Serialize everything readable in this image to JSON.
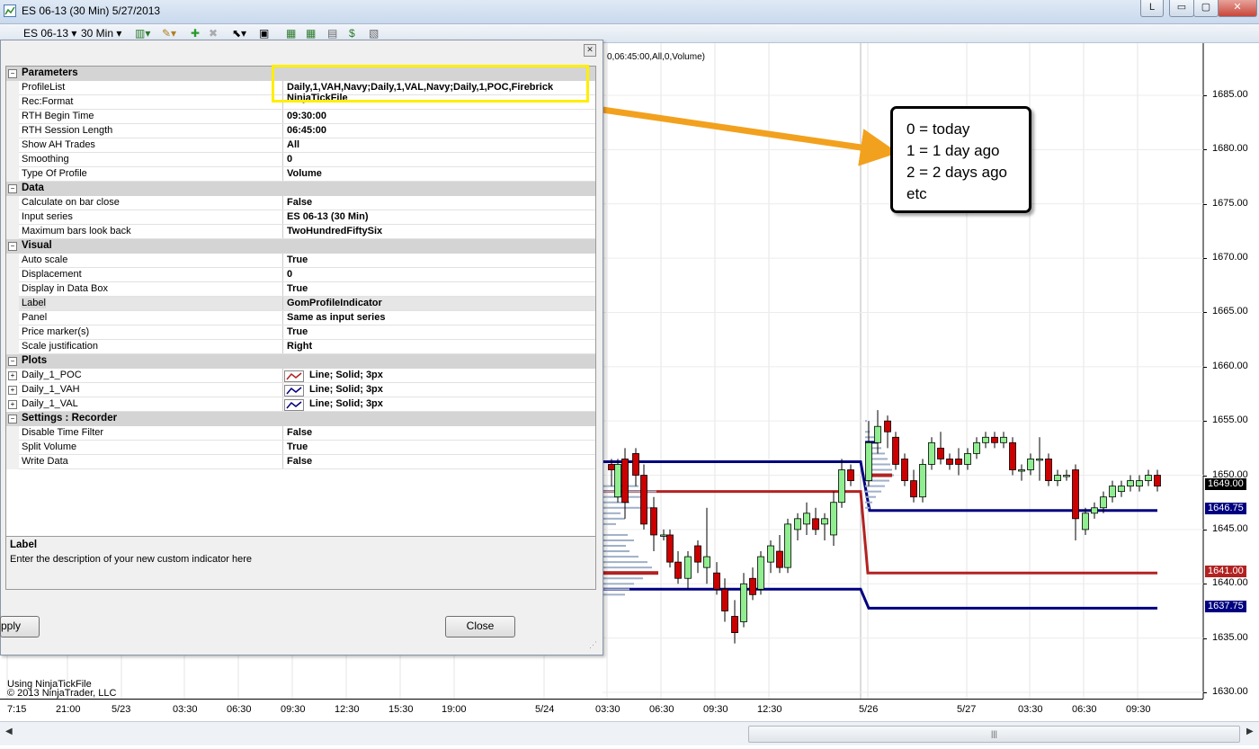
{
  "window": {
    "title": "ES 06-13 (30 Min)  5/27/2013",
    "btn_l": "L",
    "btn_minimize": "▭",
    "btn_restore": "▢",
    "btn_close": "✕"
  },
  "toolbar": {
    "instrument": "ES 06-13",
    "interval": "30 Min"
  },
  "chart": {
    "indicator_label": "0,06:45:00,All,0,Volume)",
    "footer_line1": "Using NinjaTickFile",
    "footer_line2": "© 2013 NinjaTrader, LLC",
    "y_ticks": [
      "1685.00",
      "1680.00",
      "1675.00",
      "1670.00",
      "1665.00",
      "1660.00",
      "1655.00",
      "1650.00",
      "1645.00",
      "1640.00",
      "1635.00",
      "1630.00"
    ],
    "x_ticks": [
      "7:15",
      "21:00",
      "5/23",
      "03:30",
      "06:30",
      "09:30",
      "12:30",
      "15:30",
      "19:00",
      "5/24",
      "03:30",
      "06:30",
      "09:30",
      "12:30",
      "5/26",
      "5/27",
      "03:30",
      "06:30",
      "09:30"
    ],
    "price_tags": {
      "last": "1649.00",
      "vah": "1646.75",
      "poc": "1641.00",
      "val": "1637.75"
    },
    "colors": {
      "navy": "#000080",
      "firebrick": "#b22222",
      "up": "#90ee90",
      "down": "#cc0000"
    }
  },
  "callout": {
    "lines": [
      "0 = today",
      "1 = 1 day ago",
      "2 = 2 days ago",
      "etc"
    ]
  },
  "dialog": {
    "categories": {
      "parameters": "Parameters",
      "data": "Data",
      "visual": "Visual",
      "plots": "Plots",
      "settings": "Settings : Recorder"
    },
    "props": {
      "profilelist": {
        "name": "ProfileList",
        "value": "Daily,1,VAH,Navy;Daily,1,VAL,Navy;Daily,1,POC,Firebrick"
      },
      "recformat": {
        "name": "Rec:Format",
        "value": "NinjaTickFile"
      },
      "rthbegin": {
        "name": "RTH Begin Time",
        "value": "09:30:00"
      },
      "rthlength": {
        "name": "RTH Session Length",
        "value": "06:45:00"
      },
      "showah": {
        "name": "Show AH Trades",
        "value": "All"
      },
      "smoothing": {
        "name": "Smoothing",
        "value": "0"
      },
      "typeprofile": {
        "name": "Type Of Profile",
        "value": "Volume"
      },
      "calcbar": {
        "name": "Calculate on bar close",
        "value": "False"
      },
      "inputseries": {
        "name": "Input series",
        "value": "ES 06-13 (30 Min)"
      },
      "maxbars": {
        "name": "Maximum bars look back",
        "value": "TwoHundredFiftySix"
      },
      "autoscale": {
        "name": "Auto scale",
        "value": "True"
      },
      "displacement": {
        "name": "Displacement",
        "value": "0"
      },
      "databox": {
        "name": "Display in Data Box",
        "value": "True"
      },
      "label": {
        "name": "Label",
        "value": "GomProfileIndicator"
      },
      "panel": {
        "name": "Panel",
        "value": "Same as input series"
      },
      "pricemarker": {
        "name": "Price marker(s)",
        "value": "True"
      },
      "scalejust": {
        "name": "Scale justification",
        "value": "Right"
      },
      "plot_poc": {
        "name": "Daily_1_POC",
        "value": "Line; Solid; 3px"
      },
      "plot_vah": {
        "name": "Daily_1_VAH",
        "value": "Line; Solid; 3px"
      },
      "plot_val": {
        "name": "Daily_1_VAL",
        "value": "Line; Solid; 3px"
      },
      "disabletime": {
        "name": "Disable Time Filter",
        "value": "False"
      },
      "splitvol": {
        "name": "Split Volume",
        "value": "True"
      },
      "writedata": {
        "name": "Write Data",
        "value": "False"
      }
    },
    "description": {
      "heading": "Label",
      "text": "Enter the description of your new custom indicator here"
    },
    "buttons": {
      "apply": "pply",
      "close": "Close"
    }
  }
}
